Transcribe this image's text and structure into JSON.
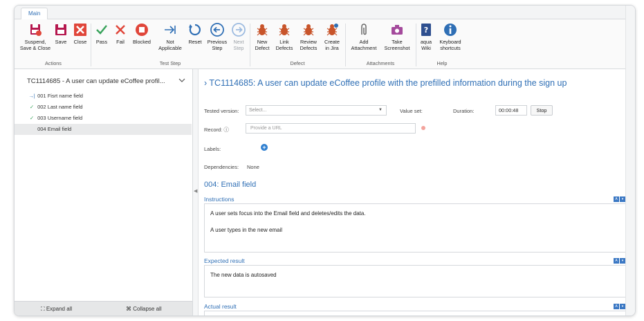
{
  "ribbon": {
    "tab": "Main",
    "buttons": {
      "suspend": {
        "label1": "Suspend,",
        "label2": "Save & Close"
      },
      "save": {
        "label1": "Save"
      },
      "close": {
        "label1": "Close"
      },
      "pass": {
        "label1": "Pass"
      },
      "fail": {
        "label1": "Fail"
      },
      "blocked": {
        "label1": "Blocked"
      },
      "not_applicable": {
        "label1": "Not",
        "label2": "Applicable"
      },
      "reset": {
        "label1": "Reset"
      },
      "previous_step": {
        "label1": "Previous",
        "label2": "Step"
      },
      "next_step": {
        "label1": "Next",
        "label2": "Step"
      },
      "new_defect": {
        "label1": "New",
        "label2": "Defect"
      },
      "link_defects": {
        "label1": "Link",
        "label2": "Defects"
      },
      "review_defects": {
        "label1": "Review",
        "label2": "Defects"
      },
      "create_in_jira": {
        "label1": "Create",
        "label2": "in Jira"
      },
      "add_attachment": {
        "label1": "Add",
        "label2": "Attachment"
      },
      "take_screenshot": {
        "label1": "Take",
        "label2": "Screenshot"
      },
      "aqua_wiki": {
        "label1": "aqua",
        "label2": "Wiki"
      },
      "keyboard_shortcuts": {
        "label1": "Keyboard",
        "label2": "shortcuts"
      }
    },
    "groups": {
      "actions": "Actions",
      "test_step": "Test Step",
      "defect": "Defect",
      "attachments": "Attachments",
      "help": "Help"
    }
  },
  "left_panel": {
    "title": "TC1114685 - A user can update eCoffee profil...",
    "steps": [
      {
        "marker": "→|",
        "label": "001 Fisrt name field"
      },
      {
        "marker": "✓",
        "label": "002 Last name field"
      },
      {
        "marker": "✓",
        "label": "003 Username field"
      },
      {
        "marker": "",
        "label": "004 Email field"
      }
    ],
    "expand_all": "Expand all",
    "collapse_all": "Collapse all"
  },
  "main": {
    "title": "TC1114685: A user can update eCoffee profile with the prefilled information during the sign up",
    "tested_version_label": "Tested version:",
    "tested_version_value": "Select...",
    "value_set_label": "Value set:",
    "duration_label": "Duration:",
    "duration_value": "00:00:48",
    "stop_label": "Stop",
    "record_label": "Record:",
    "record_placeholder": "Provide a URL",
    "labels_label": "Labels:",
    "dependencies_label": "Dependencies:",
    "dependencies_value": "None",
    "step_heading": "004: Email field",
    "instructions_title": "Instructions",
    "instructions_lines": [
      "A user sets focus into the Email field and deletes/edits the data.",
      "A user types in the new email"
    ],
    "expected_title": "Expected result",
    "expected_text": "The new data is autosaved",
    "actual_title": "Actual result"
  },
  "colors": {
    "accent": "#2f6fb5",
    "fail": "#e0463a",
    "pass": "#3aa35c",
    "save": "#b5174e"
  }
}
